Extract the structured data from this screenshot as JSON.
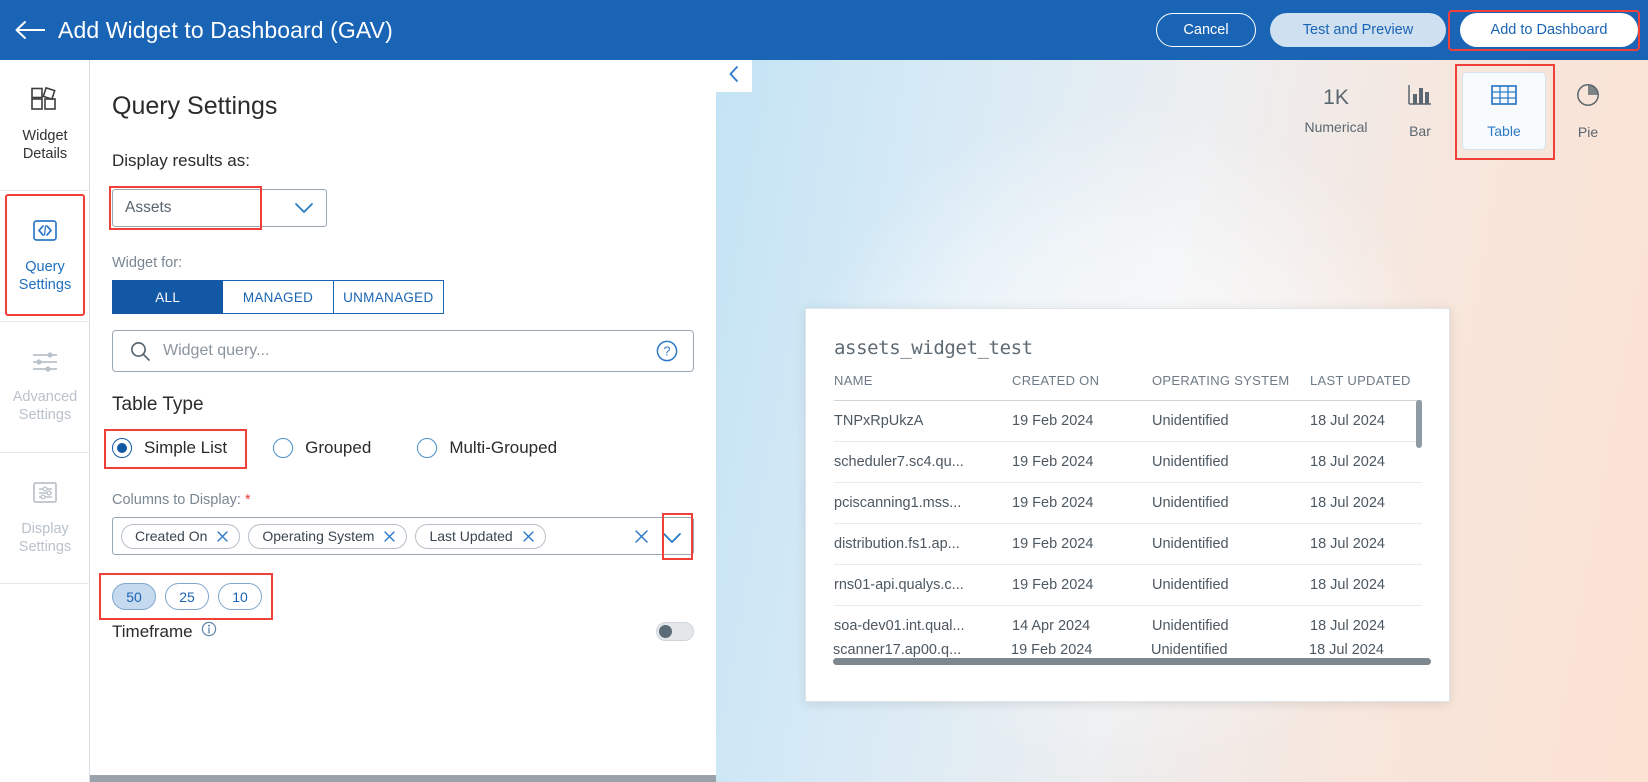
{
  "topbar": {
    "back_icon": "arrow-left-icon",
    "title": "Add Widget to Dashboard (GAV)",
    "cancel_label": "Cancel",
    "test_label": "Test and Preview",
    "add_label": "Add to Dashboard",
    "brand_blue": "#1a64b5",
    "highlight_red": "#f0403a"
  },
  "rail": {
    "items": [
      {
        "label_line1": "Widget",
        "label_line2": "Details",
        "icon": "widget-blocks-icon",
        "state": "default"
      },
      {
        "label_line1": "Query",
        "label_line2": "Settings",
        "icon": "code-brackets-icon",
        "state": "active"
      },
      {
        "label_line1": "Advanced",
        "label_line2": "Settings",
        "icon": "sliders-icon",
        "state": "disabled"
      },
      {
        "label_line1": "Display",
        "label_line2": "Settings",
        "icon": "display-list-icon",
        "state": "disabled"
      }
    ]
  },
  "form": {
    "heading": "Query Settings",
    "display_results_label": "Display results as:",
    "display_results_value": "Assets",
    "dropdown_icon": "chevron-down-icon",
    "widget_for_label": "Widget for:",
    "widget_for_options": [
      "ALL",
      "MANAGED",
      "UNMANAGED"
    ],
    "widget_for_selected": "ALL",
    "search_placeholder": "Widget query...",
    "search_value": "",
    "search_icon": "search-icon",
    "help_icon": "question-circle-icon",
    "table_type_heading": "Table Type",
    "table_type_options": [
      "Simple List",
      "Grouped",
      "Multi-Grouped"
    ],
    "table_type_selected": "Simple List",
    "columns_label": "Columns to Display:",
    "columns_required_marker": "*",
    "columns_chips": [
      "Created On",
      "Operating System",
      "Last Updated"
    ],
    "chip_remove_icon": "close-x-icon",
    "field_clear_icon": "close-x-icon",
    "field_chevron_icon": "chevron-down-icon",
    "page_size_options": [
      "50",
      "25",
      "10"
    ],
    "page_size_selected": "50",
    "timeframe_label": "Timeframe",
    "timeframe_info_icon": "info-circle-icon",
    "timeframe_enabled": false
  },
  "preview": {
    "collapse_icon": "chevron-left-icon",
    "chart_types": [
      {
        "label": "Numerical",
        "icon": "1K",
        "selected": false
      },
      {
        "label": "Bar",
        "icon": "bar-chart-icon",
        "selected": false
      },
      {
        "label": "Table",
        "icon": "table-icon",
        "selected": true
      },
      {
        "label": "Pie",
        "icon": "pie-chart-icon",
        "selected": false
      }
    ],
    "widget_title": "assets_widget_test"
  },
  "chart_data": {
    "type": "table",
    "title": "assets_widget_test",
    "columns": [
      "NAME",
      "CREATED ON",
      "OPERATING SYSTEM",
      "LAST UPDATED"
    ],
    "rows": [
      [
        "TNPxRpUkzA",
        "19 Feb 2024",
        "Unidentified",
        "18 Jul 2024"
      ],
      [
        "scheduler7.sc4.qu...",
        "19 Feb 2024",
        "Unidentified",
        "18 Jul 2024"
      ],
      [
        "pciscanning1.mss...",
        "19 Feb 2024",
        "Unidentified",
        "18 Jul 2024"
      ],
      [
        "distribution.fs1.ap...",
        "19 Feb 2024",
        "Unidentified",
        "18 Jul 2024"
      ],
      [
        "rns01-api.qualys.c...",
        "19 Feb 2024",
        "Unidentified",
        "18 Jul 2024"
      ],
      [
        "soa-dev01.int.qual...",
        "14 Apr 2024",
        "Unidentified",
        "18 Jul 2024"
      ]
    ],
    "partial_row": [
      "scanner17.ap00.q...",
      "19 Feb 2024",
      "Unidentified",
      "18 Jul 2024"
    ]
  }
}
